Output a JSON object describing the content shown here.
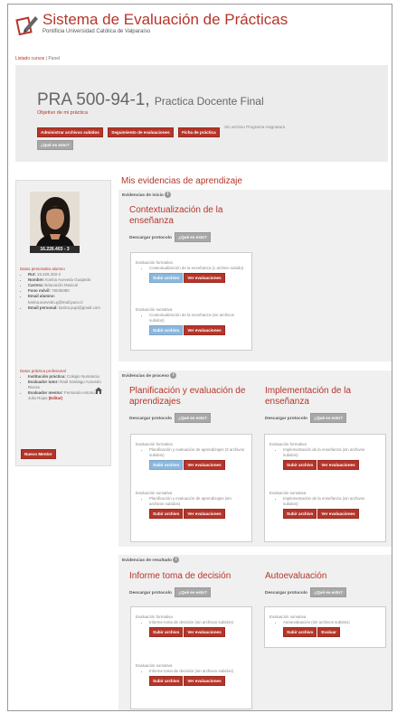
{
  "app": {
    "title": "Sistema de Evaluación de Prácticas",
    "subtitle": "Pontificia Universidad Católica de Valparaíso"
  },
  "breadcrumb": {
    "link": "Listado cursos",
    "sep": "|",
    "current": "Panel"
  },
  "course": {
    "code": "PRA 500-94-1,",
    "name": "Practica Docente Final",
    "objective": "Objetivo de mi práctica",
    "buttons": [
      "Administrar archivos subidos",
      "Seguimiento de evaluaciones",
      "Ficha de práctica"
    ],
    "note": "Sin archivo Programa Asignatura",
    "help": "¿Qué es esto?"
  },
  "student": {
    "rut_badge": "16.226.403 - 3",
    "personal_title": "Datos personales alumno",
    "personal": [
      {
        "label": "Rut:",
        "value": "16.226.403-3"
      },
      {
        "label": "Nombre:",
        "value": "Karina Acevedo Guajardo"
      },
      {
        "label": "Carrera:",
        "value": "Educación Musical"
      },
      {
        "label": "Fono móvil:",
        "value": "76035380"
      },
      {
        "label": "Email alumno:",
        "value": "karina.acevedo.g@mail.pucv.cl"
      },
      {
        "label": "Email personal:",
        "value": "karina.pupi@gmail.com"
      }
    ],
    "practice_title": "Datos práctica profesional",
    "practice": [
      {
        "label": "Institución práctica:",
        "value": "Colegio Numancia"
      },
      {
        "label": "Evaluador tutor:",
        "value": "Raúl Santiago Acevedo Rivera"
      },
      {
        "label": "Evaluador mentor:",
        "value": "Fernando Antonio Julio Rojas"
      }
    ],
    "change_link": "(Editar)",
    "new_mentor": "Nuevo Mentor"
  },
  "main": {
    "title": "Mis evidencias de aprendizaje",
    "download_label": "Descargar protocolo",
    "help": "¿Qué es esto?",
    "upload": "Subir archivo",
    "view_evals": "Ver evaluaciones",
    "evaluate": "Evaluar",
    "formative": "Evaluación formativa",
    "summative": "Evaluación sumativa",
    "sections": [
      {
        "heading": "Evidencias de inicio",
        "cols": [
          {
            "title": "Contextualización de la enseñanza",
            "formative_item": "Contextualización de la enseñanza (1 archivo subido)",
            "summative_item": "Contextualización de la enseñanza (sin archivos subidos)"
          }
        ]
      },
      {
        "heading": "Evidencias de proceso",
        "cols": [
          {
            "title": "Planificación y evaluación de aprendizajes",
            "formative_item": "Planificación y evaluación de aprendizajes (3 archivos subidos)",
            "summative_item": "Planificación y evaluación de aprendizajes (sin archivos subidos)"
          },
          {
            "title": "Implementación de la enseñanza",
            "formative_item": "Implementación de la enseñanza (sin archivos subidos)",
            "summative_item": "Implementación de la enseñanza (sin archivos subidos)"
          }
        ]
      },
      {
        "heading": "Evidencias de resultado",
        "cols": [
          {
            "title": "Informe toma de decisión",
            "formative_item": "Informe toma de decisión (sin archivos subidos)",
            "summative_item": "Informe toma de decisión (sin archivos subidos)"
          },
          {
            "title": "Autoevaluación",
            "summative_item": "Autoevaluación (sin archivos subidos)"
          }
        ]
      }
    ]
  },
  "colors": {
    "accent": "#b5352a",
    "panel": "#ececec",
    "blue_button": "#8cb7dc"
  }
}
